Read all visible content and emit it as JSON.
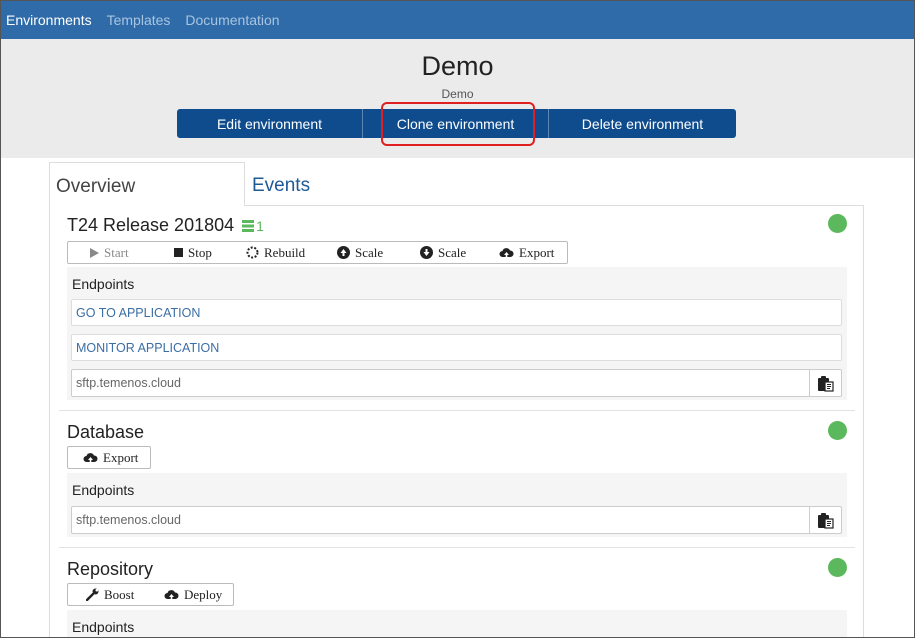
{
  "nav": {
    "items": [
      "Environments",
      "Templates",
      "Documentation"
    ]
  },
  "header": {
    "title": "Demo",
    "subtitle": "Demo",
    "buttons": [
      "Edit environment",
      "Clone environment",
      "Delete environment"
    ]
  },
  "tabs": [
    "Overview",
    "Events"
  ],
  "colors": {
    "navbar": "#2e6ba8",
    "button": "#0e4c8e",
    "status_ok": "#5cb85c",
    "highlight": "#e02020"
  },
  "sections": {
    "t24": {
      "title": "T24 Release 201804",
      "badge_count": "1",
      "actions": [
        "Start",
        "Stop",
        "Rebuild",
        "Scale",
        "Scale",
        "Export"
      ],
      "endpoints_label": "Endpoints",
      "links": [
        "GO TO APPLICATION",
        "MONITOR APPLICATION"
      ],
      "sftp": "sftp.temenos.cloud"
    },
    "database": {
      "title": "Database",
      "actions": [
        "Export"
      ],
      "endpoints_label": "Endpoints",
      "sftp": "sftp.temenos.cloud"
    },
    "repository": {
      "title": "Repository",
      "actions": [
        "Boost",
        "Deploy"
      ],
      "endpoints_label": "Endpoints"
    }
  }
}
